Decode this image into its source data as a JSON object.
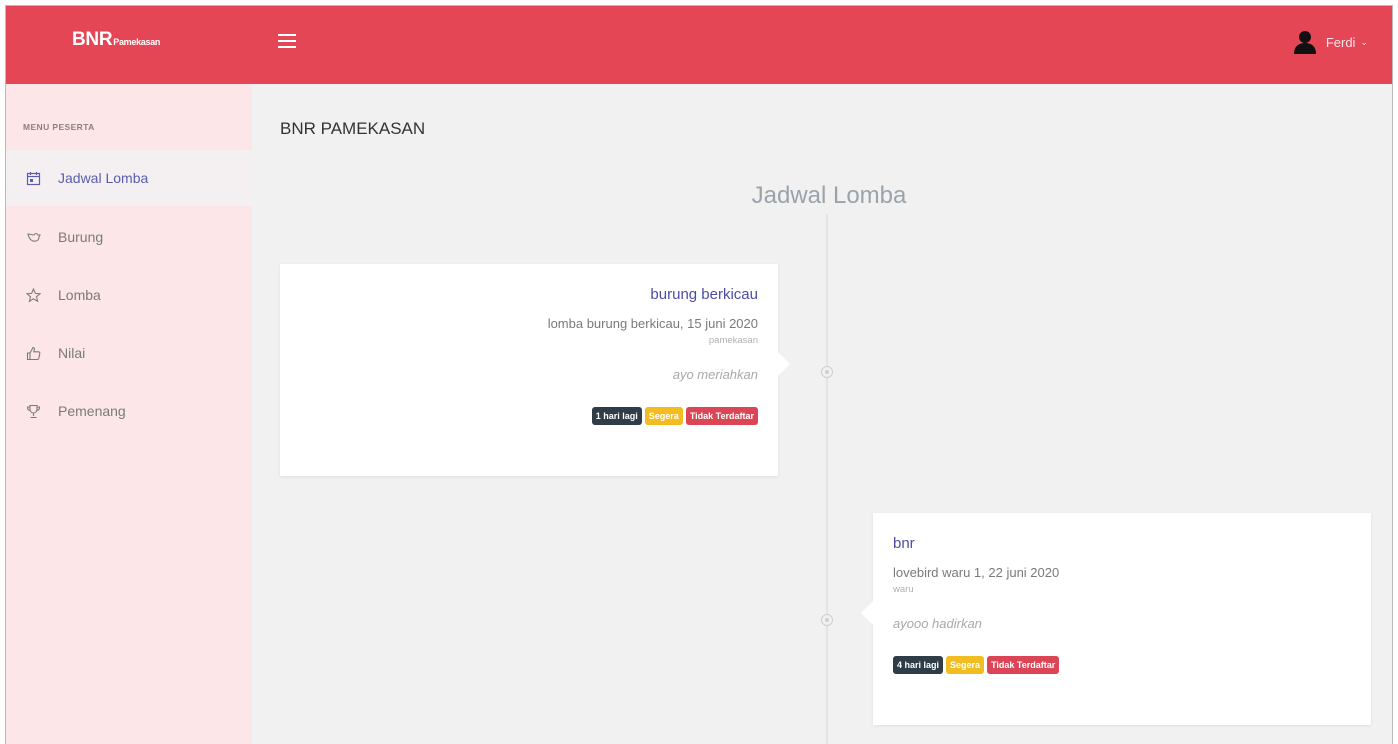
{
  "header": {
    "brand_main": "BNR",
    "brand_sub": "Pamekasan",
    "user_name": "Ferdi",
    "caret": "⌄"
  },
  "sidebar": {
    "menu_header": "MENU PESERTA",
    "items": [
      {
        "label": "Jadwal Lomba",
        "icon": "calendar-icon",
        "active": true
      },
      {
        "label": "Burung",
        "icon": "bird-icon",
        "active": false
      },
      {
        "label": "Lomba",
        "icon": "star-icon",
        "active": false
      },
      {
        "label": "Nilai",
        "icon": "thumbs-up-icon",
        "active": false
      },
      {
        "label": "Pemenang",
        "icon": "trophy-icon",
        "active": false
      }
    ]
  },
  "main": {
    "page_title": "BNR PAMEKASAN",
    "timeline_heading": "Jadwal Lomba",
    "events": [
      {
        "title": "burung berkicau",
        "description": "lomba burung berkicau, 15 juni 2020",
        "location": "pamekasan",
        "note": "ayo meriahkan",
        "badges": {
          "days": "1 hari lagi",
          "soon": "Segera",
          "status": "Tidak Terdaftar"
        }
      },
      {
        "title": "bnr",
        "description": "lovebird waru 1, 22 juni 2020",
        "location": "waru",
        "note": "ayooo hadirkan",
        "badges": {
          "days": "4 hari lagi",
          "soon": "Segera",
          "status": "Tidak Terdaftar"
        }
      }
    ]
  },
  "colors": {
    "topbar": "#e54656",
    "sidebar": "#fde6e8",
    "accent": "#4c4ca8",
    "badge_dark": "#2f3d48",
    "badge_yellow": "#f2bd20",
    "badge_red": "#dc4556"
  }
}
